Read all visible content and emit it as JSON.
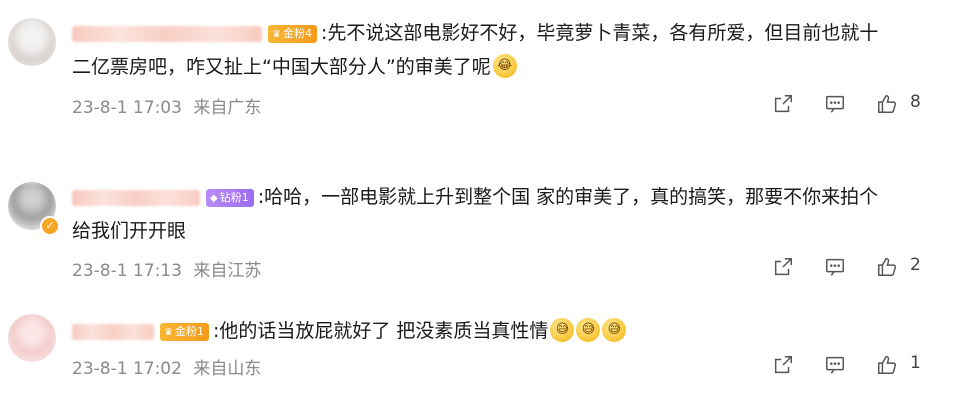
{
  "comments": [
    {
      "fan_badge": "金粉4",
      "badge_type": "gold",
      "text_line1": ":先不说这部电影好不好，毕竟萝卜青菜，各有所爱，但目前也就十",
      "text_line2": "二亿票房吧，咋又扯上“中国大部分人”的审美了呢",
      "emoji": [
        "laugh-cry-emoji"
      ],
      "time": "23-8-1 17:03",
      "location": "来自广东",
      "likes": "8"
    },
    {
      "fan_badge": "钻粉1",
      "badge_type": "violet",
      "text_line1": ":哈哈，一部电影就上升到整个国 家的审美了，真的搞笑，那要不你来拍个",
      "text_line2": "给我们开开眼",
      "time": "23-8-1 17:13",
      "location": "来自江苏",
      "likes": "2"
    },
    {
      "fan_badge": "金粉1",
      "badge_type": "gold",
      "text_line1": ":他的话当放屁就好了 把没素质当真性情",
      "emoji": [
        "awkward-smile-emoji",
        "awkward-smile-emoji",
        "awkward-smile-emoji"
      ],
      "time": "23-8-1 17:02",
      "location": "来自山东",
      "likes": "1"
    }
  ],
  "colors": {
    "meta": "#8a8a8a",
    "gold_badge": "#f5a623",
    "violet_badge": "#a775f3"
  }
}
